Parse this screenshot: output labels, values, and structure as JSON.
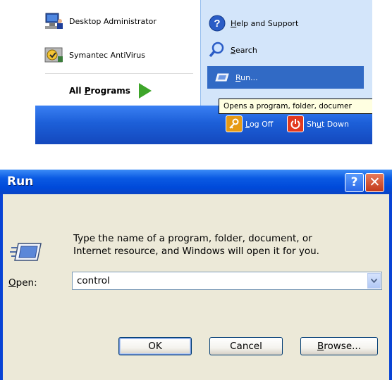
{
  "start_menu": {
    "left_items": [
      {
        "label": "Desktop Administrator",
        "icon": "computer-user-icon"
      },
      {
        "label": "Symantec AntiVirus",
        "icon": "antivirus-icon"
      }
    ],
    "all_programs": {
      "label_pre": "All ",
      "label_u": "P",
      "label_post": "rograms"
    },
    "right_items": [
      {
        "label_u": "H",
        "label_post": "elp and Support",
        "icon": "help-icon"
      },
      {
        "label_u": "S",
        "label_post": "earch",
        "icon": "search-icon"
      },
      {
        "label_u": "R",
        "label_post": "un...",
        "icon": "run-icon"
      }
    ],
    "tooltip": "Opens a program, folder, documer",
    "logoff": {
      "label_pre": "",
      "label_u": "L",
      "label_post": "og Off"
    },
    "shutdown": {
      "label_pre": "Sh",
      "label_u": "u",
      "label_post": "t Down"
    }
  },
  "run_dialog": {
    "title": "Run",
    "help_glyph": "?",
    "close_glyph": "✕",
    "description_line1": "Type the name of a program, folder, document, or",
    "description_line2": "Internet resource, and Windows will open it for you.",
    "open_label_u": "O",
    "open_label_post": "pen:",
    "input_value": "control",
    "ok_label": "OK",
    "cancel_label": "Cancel",
    "browse_label_u": "B",
    "browse_label_post": "rowse..."
  }
}
